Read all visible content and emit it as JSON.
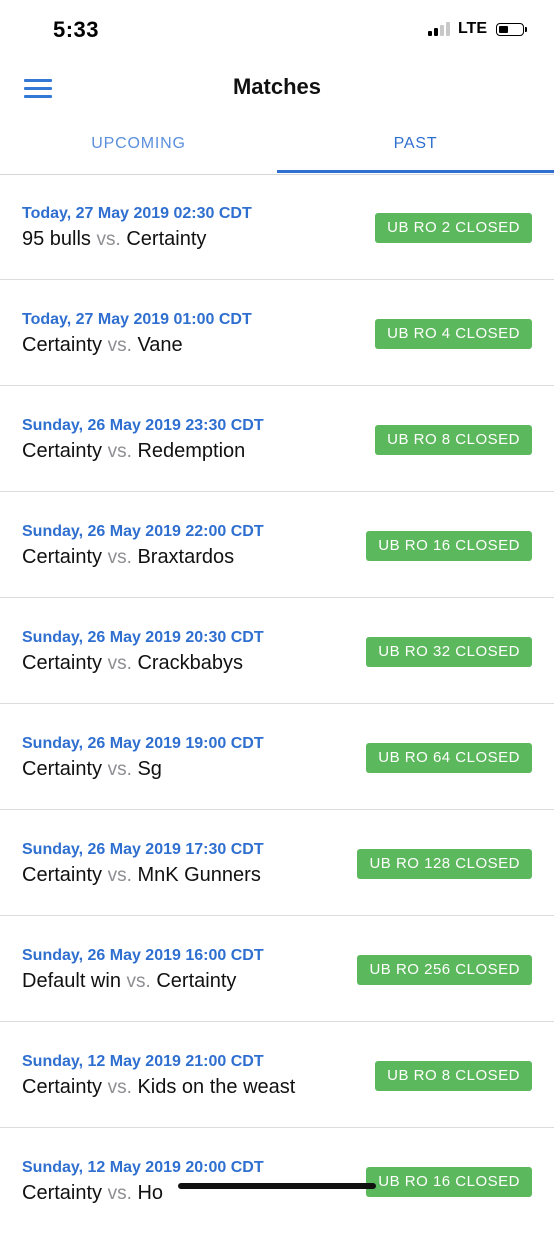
{
  "status_bar": {
    "time": "5:33",
    "network": "LTE",
    "battery_level": 0.45
  },
  "header": {
    "title": "Matches"
  },
  "tabs": [
    {
      "label": "UPCOMING",
      "active": false
    },
    {
      "label": "PAST",
      "active": true
    }
  ],
  "matches": [
    {
      "date": "Today, 27 May 2019 02:30 CDT",
      "team1": "95 bulls",
      "vs": "vs.",
      "team2": "Certainty",
      "status": "UB RO 2 CLOSED"
    },
    {
      "date": "Today, 27 May 2019 01:00 CDT",
      "team1": "Certainty",
      "vs": "vs.",
      "team2": "Vane",
      "status": "UB RO 4 CLOSED"
    },
    {
      "date": "Sunday, 26 May 2019 23:30 CDT",
      "team1": "Certainty",
      "vs": "vs.",
      "team2": "Redemption",
      "status": "UB RO 8 CLOSED"
    },
    {
      "date": "Sunday, 26 May 2019 22:00 CDT",
      "team1": "Certainty",
      "vs": "vs.",
      "team2": "Braxtardos",
      "status": "UB RO 16 CLOSED"
    },
    {
      "date": "Sunday, 26 May 2019 20:30 CDT",
      "team1": "Certainty",
      "vs": "vs.",
      "team2": "Crackbabys",
      "status": "UB RO 32 CLOSED"
    },
    {
      "date": "Sunday, 26 May 2019 19:00 CDT",
      "team1": "Certainty",
      "vs": "vs.",
      "team2": "Sg",
      "status": "UB RO 64 CLOSED"
    },
    {
      "date": "Sunday, 26 May 2019 17:30 CDT",
      "team1": "Certainty",
      "vs": "vs.",
      "team2": "MnK Gunners",
      "status": "UB RO 128 CLOSED"
    },
    {
      "date": "Sunday, 26 May 2019 16:00 CDT",
      "team1": "Default win",
      "vs": "vs.",
      "team2": "Certainty",
      "status": "UB RO 256 CLOSED"
    },
    {
      "date": "Sunday, 12 May 2019 21:00 CDT",
      "team1": "Certainty",
      "vs": "vs.",
      "team2": "Kids on the weast",
      "status": "UB RO 8 CLOSED"
    },
    {
      "date": "Sunday, 12 May 2019 20:00 CDT",
      "team1": "Certainty",
      "vs": "vs.",
      "team2": "Ho",
      "status": "UB RO 16 CLOSED"
    }
  ],
  "colors": {
    "accent": "#2f6fd0",
    "badge": "#5cb85c",
    "vs": "#8e8e93"
  }
}
